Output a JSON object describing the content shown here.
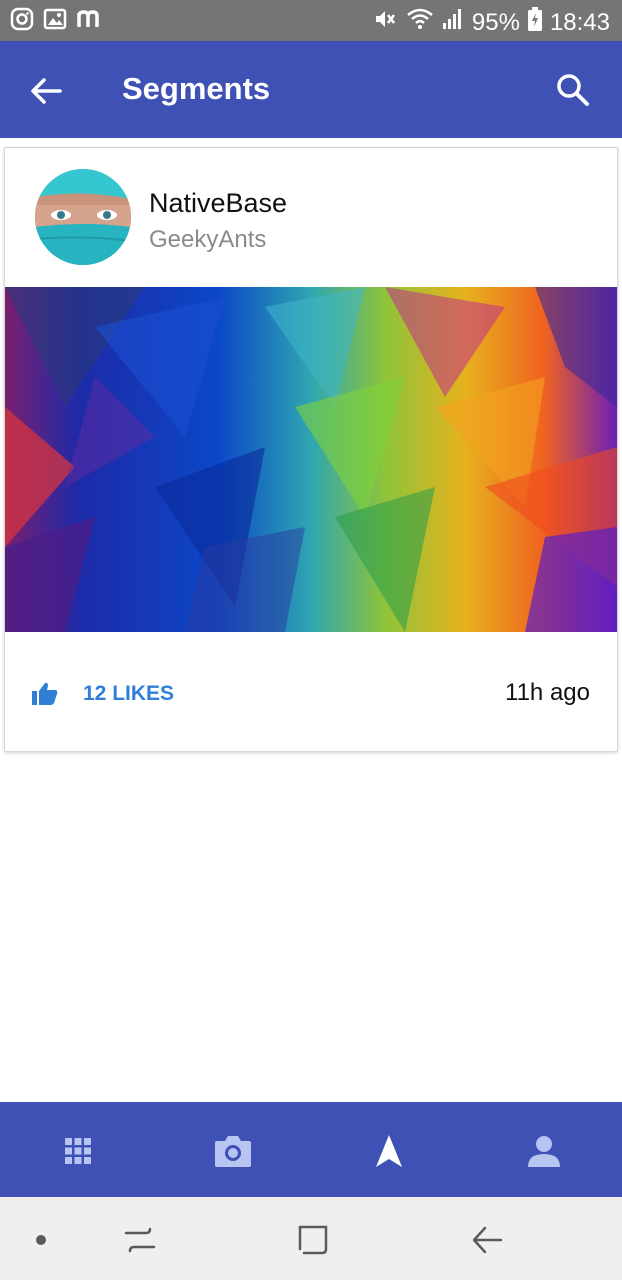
{
  "status_bar": {
    "battery": "95%",
    "time": "18:43",
    "left_icons": [
      "instagram-icon",
      "gallery-icon",
      "m-icon"
    ],
    "right_icons": [
      "mute-icon",
      "wifi-icon",
      "signal-icon",
      "battery-icon"
    ]
  },
  "header": {
    "title": "Segments",
    "back_icon": "arrow-left-icon",
    "search_icon": "search-icon",
    "color": "#3f51b5"
  },
  "card": {
    "title": "NativeBase",
    "subtitle": "GeekyAnts",
    "likes_label": "12 LIKES",
    "time": "11h ago",
    "like_icon": "thumbs-up-icon",
    "like_color": "#2f7fd7"
  },
  "footer": {
    "tabs": [
      {
        "icon": "apps-grid-icon",
        "active": false
      },
      {
        "icon": "camera-icon",
        "active": false
      },
      {
        "icon": "navigate-icon",
        "active": true
      },
      {
        "icon": "person-icon",
        "active": false
      }
    ]
  },
  "system_nav": {
    "buttons": [
      "dot-icon",
      "recents-icon",
      "home-icon",
      "back-icon"
    ]
  }
}
